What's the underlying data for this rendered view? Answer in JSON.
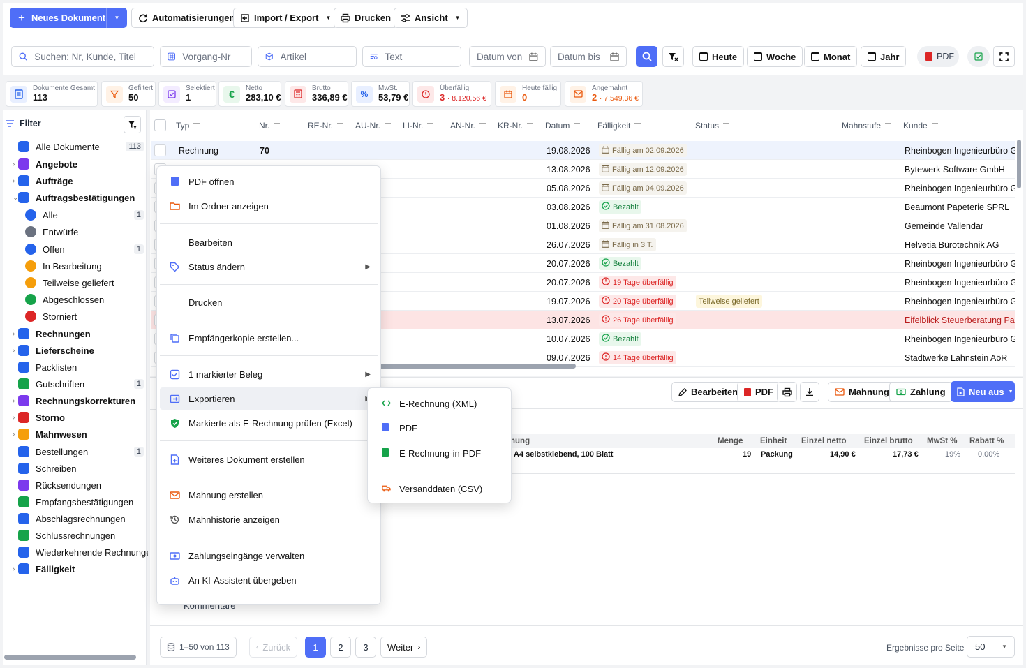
{
  "toolbar": {
    "new_doc": "Neues Dokument",
    "automations": "Automatisierungen",
    "import_export": "Import / Export",
    "print": "Drucken",
    "view": "Ansicht"
  },
  "search": {
    "main_placeholder": "Suchen: Nr, Kunde, Titel",
    "vorgang_placeholder": "Vorgang-Nr",
    "artikel_placeholder": "Artikel",
    "text_placeholder": "Text",
    "date_from": "Datum von",
    "date_to": "Datum bis",
    "today": "Heute",
    "week": "Woche",
    "month": "Monat",
    "year": "Jahr",
    "pdf": "PDF"
  },
  "kpis": [
    {
      "label": "Dokumente Gesamt",
      "value": "113"
    },
    {
      "label": "Gefiltert",
      "value": "50"
    },
    {
      "label": "Selektiert",
      "value": "1"
    },
    {
      "label": "Netto",
      "value": "283,10 €"
    },
    {
      "label": "Brutto",
      "value": "336,89 €"
    },
    {
      "label": "MwSt.",
      "value": "53,79 €"
    },
    {
      "label": "Überfällig",
      "value": "3",
      "sub": "· 8.120,56 €"
    },
    {
      "label": "Heute fällig",
      "value": "0"
    },
    {
      "label": "Angemahnt",
      "value": "2",
      "sub": "· 7.549,36 €"
    }
  ],
  "sidebar": {
    "title": "Filter",
    "items": [
      {
        "label": "Alle Dokumente",
        "count": "113",
        "bold": false,
        "color": "#2563eb"
      },
      {
        "label": "Angebote",
        "bold": true,
        "color": "#7c3aed"
      },
      {
        "label": "Aufträge",
        "bold": true,
        "color": "#2563eb"
      },
      {
        "label": "Auftragsbestätigungen",
        "bold": true,
        "color": "#2563eb"
      },
      {
        "label": "Alle",
        "count": "1",
        "color": "#2563eb"
      },
      {
        "label": "Entwürfe",
        "color": "#6b7280"
      },
      {
        "label": "Offen",
        "count": "1",
        "color": "#2563eb"
      },
      {
        "label": "In Bearbeitung",
        "color": "#f59e0b"
      },
      {
        "label": "Teilweise geliefert",
        "color": "#f59e0b"
      },
      {
        "label": "Abgeschlossen",
        "color": "#16a34a"
      },
      {
        "label": "Storniert",
        "color": "#dc2626"
      },
      {
        "label": "Rechnungen",
        "bold": true,
        "color": "#2563eb"
      },
      {
        "label": "Lieferscheine",
        "bold": true,
        "color": "#2563eb"
      },
      {
        "label": "Packlisten",
        "color": "#2563eb"
      },
      {
        "label": "Gutschriften",
        "count": "1",
        "color": "#16a34a"
      },
      {
        "label": "Rechnungskorrekturen",
        "bold": true,
        "color": "#7c3aed"
      },
      {
        "label": "Storno",
        "bold": true,
        "color": "#dc2626"
      },
      {
        "label": "Mahnwesen",
        "bold": true,
        "color": "#f59e0b"
      },
      {
        "label": "Bestellungen",
        "count": "1",
        "color": "#2563eb"
      },
      {
        "label": "Schreiben",
        "color": "#2563eb"
      },
      {
        "label": "Rücksendungen",
        "color": "#7c3aed"
      },
      {
        "label": "Empfangsbestätigungen",
        "color": "#16a34a"
      },
      {
        "label": "Abschlagsrechnungen",
        "color": "#2563eb"
      },
      {
        "label": "Schlussrechnungen",
        "color": "#16a34a"
      },
      {
        "label": "Wiederkehrende Rechnungen",
        "color": "#2563eb"
      },
      {
        "label": "Fälligkeit",
        "bold": true,
        "color": "#2563eb"
      }
    ]
  },
  "table": {
    "columns": [
      "Typ",
      "Nr.",
      "RE-Nr.",
      "AU-Nr.",
      "LI-Nr.",
      "AN-Nr.",
      "KR-Nr.",
      "Datum",
      "Fälligkeit",
      "Status",
      "Mahnstufe",
      "Kunde"
    ],
    "rows": [
      {
        "typ": "Rechnung",
        "nr": "70",
        "datum": "19.08.2026",
        "faell": "Fällig am 02.09.2026",
        "kind": "due",
        "status": "",
        "kunde": "Rheinbogen Ingenieurbüro GmbH"
      },
      {
        "typ": "",
        "nr": "",
        "datum": "13.08.2026",
        "faell": "Fällig am 12.09.2026",
        "kind": "due",
        "status": "",
        "kunde": "Bytewerk Software GmbH"
      },
      {
        "typ": "",
        "nr": "",
        "datum": "05.08.2026",
        "faell": "Fällig am 04.09.2026",
        "kind": "due",
        "status": "",
        "kunde": "Rheinbogen Ingenieurbüro GmbH"
      },
      {
        "typ": "",
        "nr": "",
        "datum": "03.08.2026",
        "faell": "Bezahlt",
        "kind": "paid",
        "status": "",
        "kunde": "Beaumont Papeterie SPRL"
      },
      {
        "typ": "",
        "nr": "",
        "datum": "01.08.2026",
        "faell": "Fällig am 31.08.2026",
        "kind": "due",
        "status": "",
        "kunde": "Gemeinde Vallendar"
      },
      {
        "typ": "",
        "nr": "",
        "datum": "26.07.2026",
        "faell": "Fällig in 3 T.",
        "kind": "due",
        "status": "",
        "kunde": "Helvetia Bürotechnik AG"
      },
      {
        "typ": "",
        "nr": "",
        "datum": "20.07.2026",
        "faell": "Bezahlt",
        "kind": "paid",
        "status": "",
        "kunde": "Rheinbogen Ingenieurbüro GmbH"
      },
      {
        "typ": "",
        "nr": "",
        "datum": "20.07.2026",
        "faell": "19 Tage überfällig",
        "kind": "over",
        "status": "",
        "kunde": "Rheinbogen Ingenieurbüro GmbH"
      },
      {
        "typ": "",
        "nr": "",
        "datum": "19.07.2026",
        "faell": "20 Tage überfällig",
        "kind": "over",
        "status": "Teilweise geliefert",
        "kunde": "Rheinbogen Ingenieurbüro GmbH"
      },
      {
        "typ": "",
        "nr": "",
        "datum": "13.07.2026",
        "faell": "26 Tage überfällig",
        "kind": "over",
        "status": "",
        "kunde": "Eifelblick Steuerberatung PartG"
      },
      {
        "typ": "",
        "nr": "",
        "datum": "10.07.2026",
        "faell": "Bezahlt",
        "kind": "paid",
        "status": "",
        "kunde": "Rheinbogen Ingenieurbüro GmbH"
      },
      {
        "typ": "",
        "nr": "",
        "datum": "09.07.2026",
        "faell": "14 Tage überfällig",
        "kind": "over",
        "status": "",
        "kunde": "Stadtwerke Lahnstein AöR"
      }
    ]
  },
  "detail_toolbar": {
    "edit": "Bearbeiten",
    "pdf": "PDF",
    "reminder": "Mahnung",
    "payment": "Zahlung",
    "new_from": "Neu aus"
  },
  "detail": {
    "headers": [
      "nung",
      "Menge",
      "Einheit",
      "Einzel netto",
      "Einzel brutto",
      "MwSt %",
      "Rabatt %"
    ],
    "row": [
      "A4 selbstklebend, 100 Blatt",
      "19",
      "Packung",
      "14,90 €",
      "17,73 €",
      "19%",
      "0,00%"
    ],
    "left_tab": "Kommentare"
  },
  "context_menu": {
    "items": [
      "PDF öffnen",
      "Im Ordner anzeigen",
      "Bearbeiten",
      "Status ändern",
      "Drucken",
      "Empfängerkopie erstellen...",
      "1 markierter Beleg",
      "Exportieren",
      "Markierte als E-Rechnung prüfen (Excel)",
      "Weiteres Dokument erstellen",
      "Mahnung erstellen",
      "Mahnhistorie anzeigen",
      "Zahlungseingänge verwalten",
      "An KI-Assistent übergeben"
    ]
  },
  "submenu": {
    "items": [
      "E-Rechnung (XML)",
      "PDF",
      "E-Rechnung-in-PDF",
      "Versanddaten (CSV)"
    ]
  },
  "pagination": {
    "range": "1–50 von 113",
    "prev": "Zurück",
    "pages": [
      "1",
      "2",
      "3"
    ],
    "next": "Weiter",
    "per_page_label": "Ergebnisse pro Seite",
    "per_page": "50"
  },
  "colors": {
    "accent": "#4f6ef7",
    "overdue": "#dc2626",
    "paid": "#16a34a"
  }
}
